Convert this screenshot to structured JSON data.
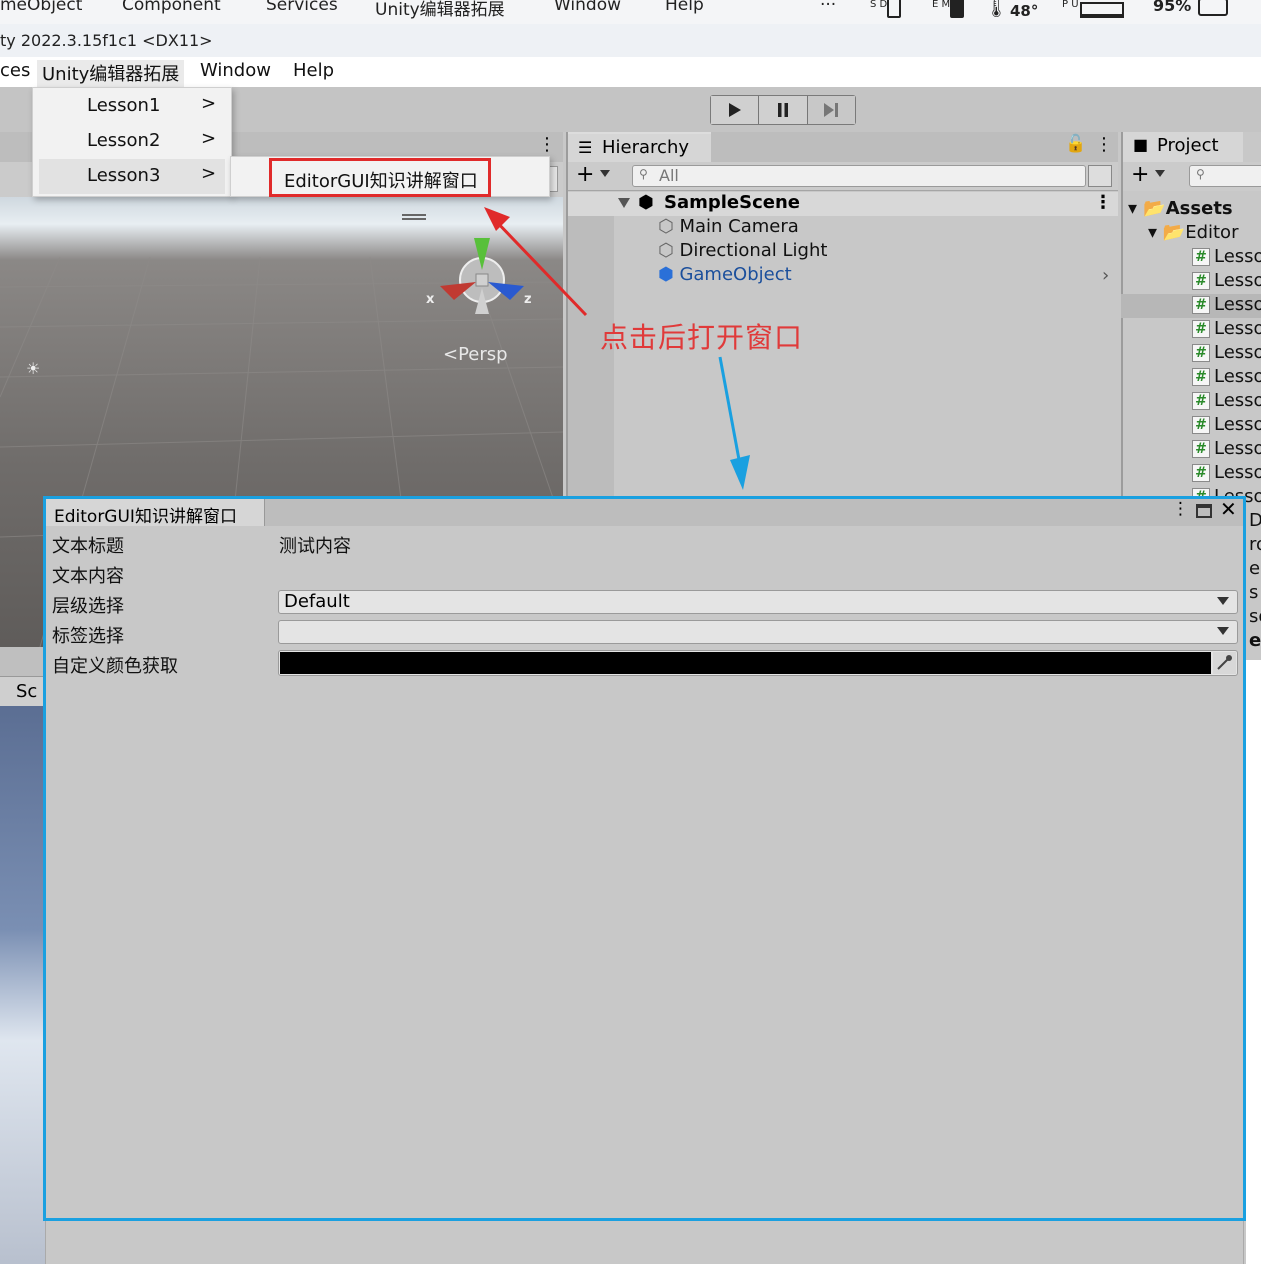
{
  "sysbar": {
    "menus": [
      "meObject",
      "Component",
      "Services",
      "Unity编辑器拓展",
      "Window",
      "Help"
    ],
    "more": "···",
    "status_sd": "S D",
    "status_em": "E M",
    "temp": "48°",
    "status_pu": "P U",
    "battery": "95%"
  },
  "titlebar": {
    "text": "ty 2022.3.15f1c1 <DX11>"
  },
  "menubar": {
    "items": [
      "ces",
      "Unity编辑器拓展",
      "Window",
      "Help"
    ]
  },
  "menu": {
    "items": [
      {
        "label": "Lesson1",
        "chevron": ">"
      },
      {
        "label": "Lesson2",
        "chevron": ">"
      },
      {
        "label": "Lesson3",
        "chevron": ">"
      }
    ],
    "submenu_item": "EditorGUI知识讲解窗口"
  },
  "scene": {
    "persp_label": "Persp",
    "axis_x": "x",
    "axis_z": "z",
    "lower_tab": "Sc"
  },
  "hierarchy": {
    "tab": "Hierarchy",
    "search_placeholder": "All",
    "scene_name": "SampleScene",
    "objects": [
      "Main Camera",
      "Directional Light",
      "GameObject"
    ]
  },
  "project": {
    "tab": "Project",
    "assets": "Assets",
    "editor": "Editor",
    "files": [
      "Lesso",
      "Lesso",
      "Lesso",
      "Lesso",
      "Lesso",
      "Lesso",
      "Lesso",
      "Lesso",
      "Lesso",
      "Lesso",
      "Lesso"
    ],
    "clipped": [
      "D",
      "ro",
      "es",
      "s",
      "so",
      "es"
    ]
  },
  "annotation": {
    "text": "点击后打开窗口",
    "red_arrow_color": "#e02a2a",
    "blue_arrow_color": "#1aa0e0"
  },
  "editor_window": {
    "tab": "EditorGUI知识讲解窗口",
    "fields": [
      {
        "label": "文本标题",
        "value": "测试内容"
      },
      {
        "label": "文本内容",
        "value": ""
      },
      {
        "label": "层级选择",
        "value": "Default"
      },
      {
        "label": "标签选择",
        "value": ""
      },
      {
        "label": "自定义颜色获取",
        "value": ""
      }
    ],
    "color_value": "#000000"
  }
}
